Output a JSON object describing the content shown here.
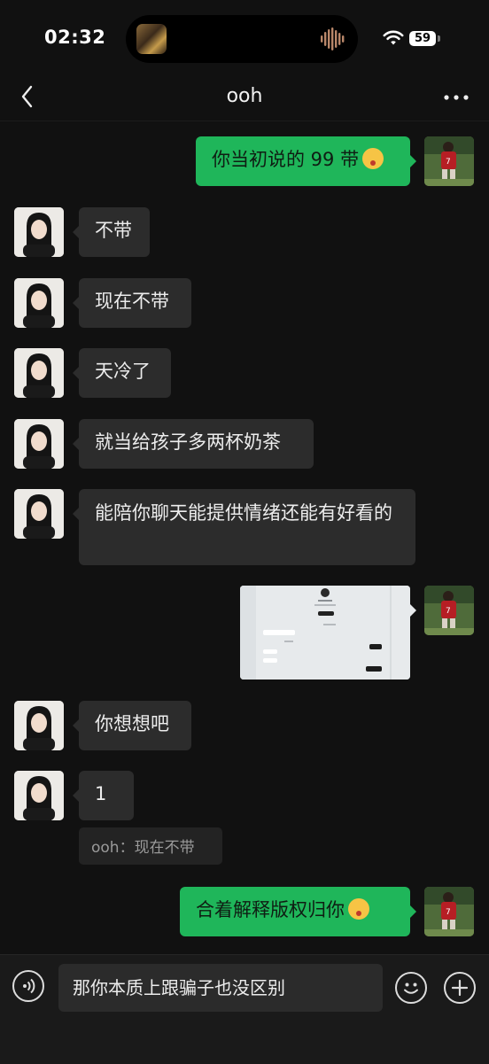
{
  "status_bar": {
    "time": "02:32",
    "battery": "59"
  },
  "header": {
    "title": "ooh"
  },
  "messages": [
    {
      "side": "right",
      "text": "你当初说的 99 带",
      "emoji": "kissing-face-emoji"
    },
    {
      "side": "left",
      "text": "不带"
    },
    {
      "side": "left",
      "text": "现在不带"
    },
    {
      "side": "left",
      "text": "天冷了"
    },
    {
      "side": "left",
      "text": "就当给孩子多两杯奶茶"
    },
    {
      "side": "left",
      "text": "能陪你聊天能提供情绪还能有好看的"
    },
    {
      "side": "right",
      "type": "image"
    },
    {
      "side": "left",
      "text": "你想想吧"
    },
    {
      "side": "left",
      "text": "1",
      "quote": "ooh：现在不带"
    },
    {
      "side": "right",
      "text": "合着解释版权归你",
      "emoji": "laughing-face-emoji"
    }
  ],
  "input": {
    "value": "那你本质上跟骗子也没区别"
  },
  "colors": {
    "background": "#111111",
    "bubble_left": "#2c2c2c",
    "bubble_right": "#1fb65a"
  }
}
